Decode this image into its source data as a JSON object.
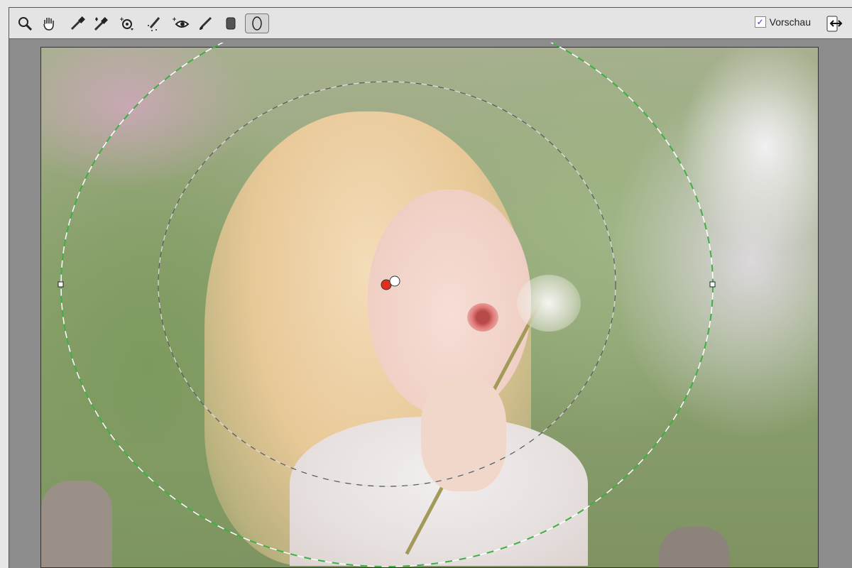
{
  "toolbar": {
    "tools": [
      {
        "name": "zoom-tool",
        "icon": "magnifier-icon"
      },
      {
        "name": "hand-tool",
        "icon": "hand-icon"
      },
      {
        "name": "white-balance-tool",
        "icon": "eyedropper-icon"
      },
      {
        "name": "color-sampler-tool",
        "icon": "eyedropper-plus-icon"
      },
      {
        "name": "targeted-adjustment-tool",
        "icon": "target-icon"
      },
      {
        "name": "spot-removal-tool",
        "icon": "healing-brush-icon"
      },
      {
        "name": "red-eye-tool",
        "icon": "eye-icon"
      },
      {
        "name": "adjustment-brush-tool",
        "icon": "brush-icon"
      },
      {
        "name": "graduated-filter-tool",
        "icon": "gradient-icon"
      },
      {
        "name": "radial-filter-tool",
        "icon": "ellipse-icon",
        "active": true
      }
    ],
    "preview_label": "Vorschau",
    "preview_checked": true,
    "checkmark": "✓"
  },
  "colors": {
    "outer_ring": "#3cb043",
    "inner_ring": "#555555",
    "pin_active": "#e0301e"
  }
}
